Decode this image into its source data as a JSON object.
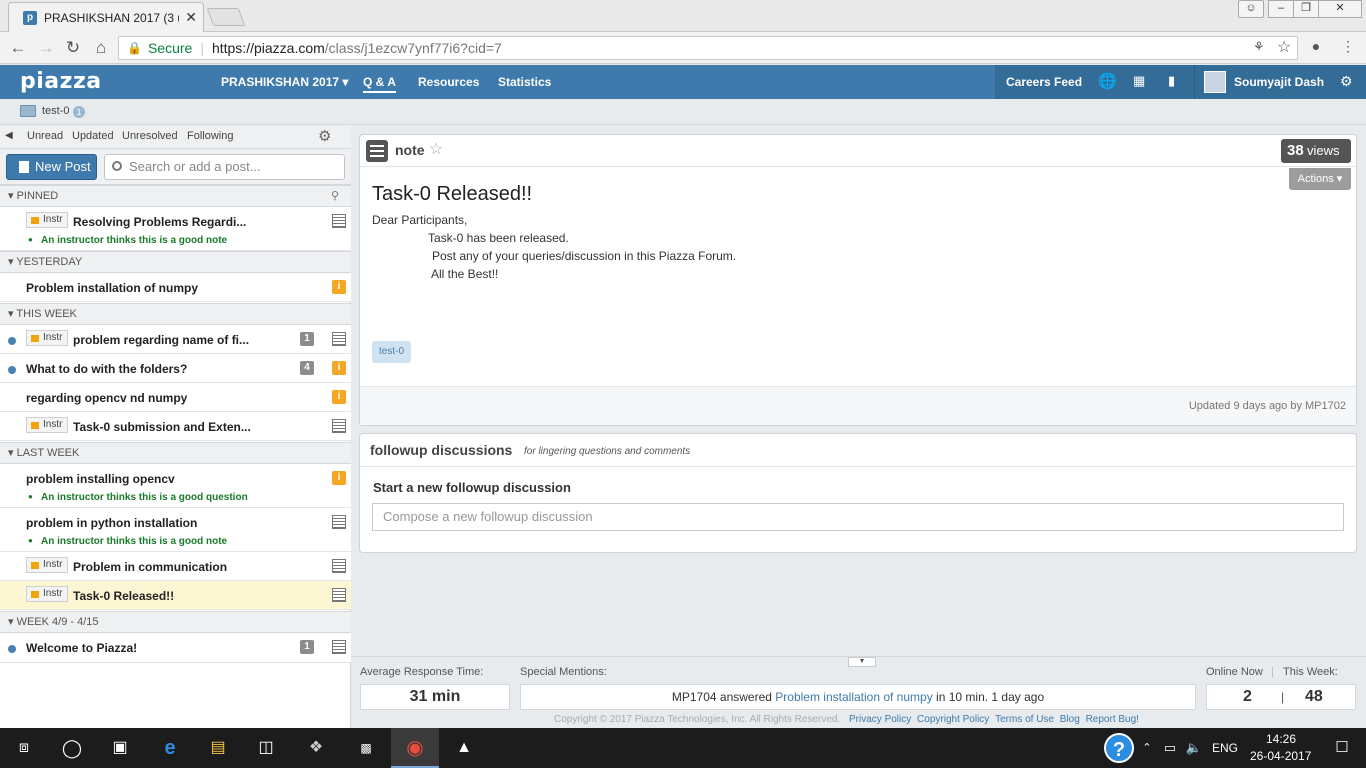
{
  "browser": {
    "tab_title": "PRASHIKSHAN 2017 (3 u",
    "tab_close": "✕",
    "secure_label": "Secure",
    "url_host": "https://piazza.com",
    "url_path": "/class/j1ezcw7ynf77i6?cid=7"
  },
  "topnav": {
    "logo": "piazza",
    "course": "PRASHIKSHAN 2017 ▾",
    "tabs": [
      "Q & A",
      "Resources",
      "Statistics"
    ],
    "careers": "Careers Feed",
    "user": "Soumyajit Dash"
  },
  "folder_bar": {
    "folder": "test-0",
    "count": "1"
  },
  "filters": [
    "Unread",
    "Updated",
    "Unresolved",
    "Following"
  ],
  "new_post": "New Post",
  "search_placeholder": "Search or add a post...",
  "sections": {
    "pinned": "PINNED",
    "yesterday": "YESTERDAY",
    "this_week": "THIS WEEK",
    "last_week": "LAST WEEK",
    "week": "WEEK 4/9 - 4/15"
  },
  "posts": {
    "p1": {
      "badge": "Instr",
      "title": "Resolving Problems Regardi...",
      "sub": "An instructor thinks this is a good note"
    },
    "p2": {
      "title": "Problem installation of numpy",
      "icon": "i"
    },
    "p3": {
      "badge": "Instr",
      "title": "problem regarding name of fi...",
      "count": "1"
    },
    "p4": {
      "title": "What to do with the folders?",
      "count": "4",
      "icon": "i"
    },
    "p5": {
      "title": "regarding opencv nd numpy",
      "icon": "i"
    },
    "p6": {
      "badge": "Instr",
      "title": "Task-0 submission and Exten..."
    },
    "p7": {
      "title": "problem installing opencv",
      "sub": "An instructor thinks this is a good question",
      "icon": "i"
    },
    "p8": {
      "title": "problem in python installation",
      "sub": "An instructor thinks this is a good note"
    },
    "p9": {
      "badge": "Instr",
      "title": "Problem in communication"
    },
    "p10": {
      "badge": "Instr",
      "title": "Task-0 Released!!"
    },
    "p11": {
      "title": "Welcome to Piazza!",
      "count": "1"
    }
  },
  "note": {
    "type": "note",
    "views_num": "38",
    "views_label": "views",
    "actions": "Actions ▾",
    "title": "Task-0 Released!!",
    "line1": "Dear Participants,",
    "line2": "Task-0 has been released.",
    "line3": "Post any of your queries/discussion in this Piazza Forum.",
    "line4": "All the Best!!",
    "tag": "test-0",
    "updated": "Updated 9 days ago by MP1702"
  },
  "followup": {
    "title": "followup discussions",
    "subtitle": "for lingering questions and comments",
    "start": "Start a new followup discussion",
    "placeholder": "Compose a new followup discussion"
  },
  "footer": {
    "avg_label": "Average Response Time:",
    "avg_value": "31 min",
    "mentions_label": "Special Mentions:",
    "mention_pre": "MP1704 answered",
    "mention_link": "Problem installation of numpy",
    "mention_post": "in 10 min. 1 day ago",
    "online_label": "Online Now",
    "week_label": "This Week:",
    "online_value": "2",
    "week_value": "48",
    "copyright": "Copyright © 2017 Piazza Technologies, Inc. All Rights Reserved.",
    "links": [
      "Privacy Policy",
      "Copyright Policy",
      "Terms of Use",
      "Blog",
      "Report Bug!"
    ]
  },
  "taskbar": {
    "lang": "ENG",
    "time": "14:26",
    "date": "26-04-2017"
  },
  "colors": {
    "piazza_blue": "#3e7aab",
    "warning": "#f5a623",
    "selected_row": "#fcf6d3"
  }
}
